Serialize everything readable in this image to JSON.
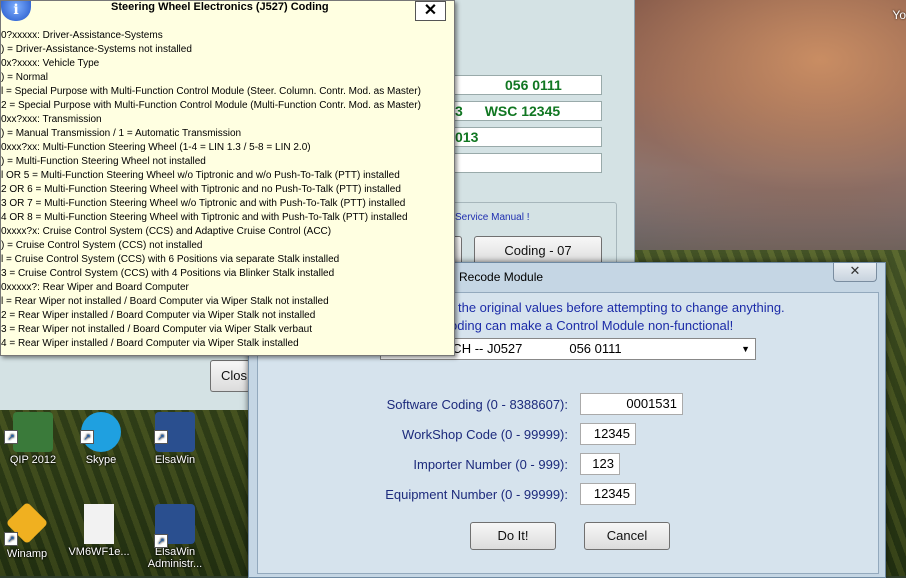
{
  "desktop": {
    "corner_text": "Yo",
    "icons": [
      {
        "label": "QIP 2012",
        "color": "#3a7a3a"
      },
      {
        "label": "Skype",
        "color": "#1fa0e0"
      },
      {
        "label": "ElsaWin",
        "color": "#2a4f8f"
      },
      {
        "label": "Winamp",
        "color": "#f0b020"
      },
      {
        "label": "VM6WF1e...",
        "color": "#f2f2f2"
      },
      {
        "label": "ElsaWin Administr...",
        "color": "#2a4f8f"
      }
    ]
  },
  "main_window": {
    "field1": "056 0111",
    "field2_a": "3",
    "field2_b": "WSC 12345",
    "field3": "013",
    "service_manual": "Service Manual !",
    "coding_button": "Coding - 07",
    "close_button": "Clos"
  },
  "recode": {
    "title": "Recode Module",
    "close_glyph": "✕",
    "warning1": "the original values before attempting to change anything.",
    "warning2": "oding can make a Control Module non-functional!",
    "module_select": "549 CH -- J0527             056 0111",
    "fields": [
      {
        "label": "Software Coding (0 - 8388607):",
        "value": "0001531"
      },
      {
        "label": "WorkShop Code (0 - 99999):",
        "value": "12345"
      },
      {
        "label": "Importer Number (0 - 999):",
        "value": "123"
      },
      {
        "label": "Equipment Number (0 - 99999):",
        "value": "12345"
      }
    ],
    "do_it_button": "Do It!",
    "cancel_button": "Cancel"
  },
  "info_popup": {
    "icon_glyph": "i",
    "title": "Steering Wheel Electronics (J527) Coding",
    "close_glyph": "✕",
    "lines": [
      "0?xxxxx: Driver-Assistance-Systems",
      ") = Driver-Assistance-Systems not installed",
      "0x?xxxx: Vehicle Type",
      ") = Normal",
      "l = Special Purpose with Multi-Function Control Module (Steer. Column. Contr. Mod. as Master)",
      "2 = Special Purpose with Multi-Function Control Module (Multi-Function Contr. Mod. as Master)",
      "0xx?xxx: Transmission",
      ") = Manual Transmission / 1 = Automatic Transmission",
      "0xxx?xx: Multi-Function Steering Wheel (1-4 = LIN 1.3 / 5-8 = LIN 2.0)",
      ") = Multi-Function Steering Wheel not installed",
      "l OR 5 = Multi-Function Steering Wheel w/o Tiptronic and w/o Push-To-Talk (PTT) installed",
      "2 OR 6 = Multi-Function Steering Wheel with Tiptronic and no Push-To-Talk (PTT) installed",
      "3 OR 7 = Multi-Function Steering Wheel w/o Tiptronic and with Push-To-Talk (PTT) installed",
      "4 OR 8 = Multi-Function Steering Wheel with Tiptronic and with Push-To-Talk (PTT) installed",
      "0xxxx?x: Cruise Control System (CCS) and Adaptive Cruise Control (ACC)",
      ") = Cruise Control System (CCS) not installed",
      "l = Cruise Control System (CCS) with 6 Positions via separate Stalk installed",
      "3 = Cruise Control System (CCS) with 4 Positions via Blinker Stalk installed",
      "0xxxxx?: Rear Wiper and Board Computer",
      "l = Rear Wiper not installed / Board Computer via Wiper Stalk not installed",
      "2 = Rear Wiper installed / Board Computer via Wiper Stalk not installed",
      "3 = Rear Wiper not installed / Board Computer via Wiper Stalk verbaut",
      "4 = Rear Wiper installed / Board Computer via Wiper Stalk installed"
    ]
  }
}
